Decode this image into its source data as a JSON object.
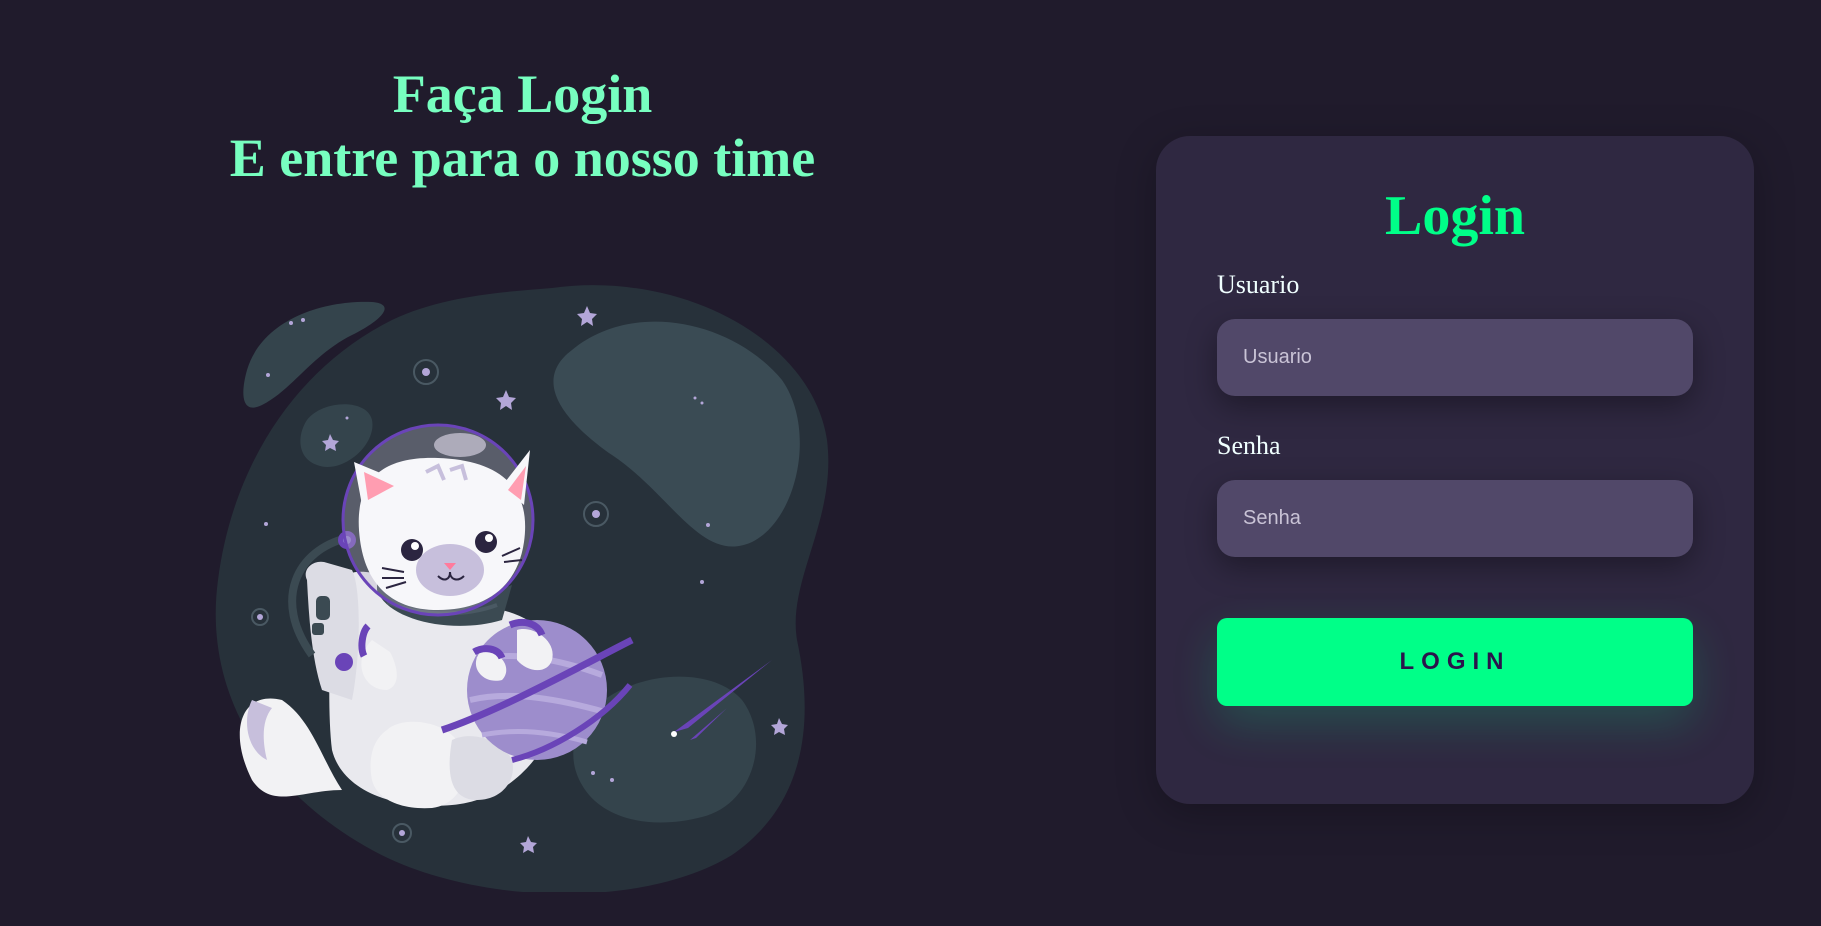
{
  "hero": {
    "line1": "Faça Login",
    "line2": "E entre para o nosso time"
  },
  "login_card": {
    "title": "Login",
    "username": {
      "label": "Usuario",
      "placeholder": "Usuario",
      "value": ""
    },
    "password": {
      "label": "Senha",
      "placeholder": "Senha",
      "value": ""
    },
    "submit_label": "Login"
  },
  "illustration": {
    "icon": "astronaut-cat-illustration"
  },
  "colors": {
    "background": "#201b2c",
    "card": "#2f2841",
    "input": "#514869",
    "accent": "#00ff88",
    "hero_text": "#77ffc0",
    "button_text": "#2b134b"
  }
}
